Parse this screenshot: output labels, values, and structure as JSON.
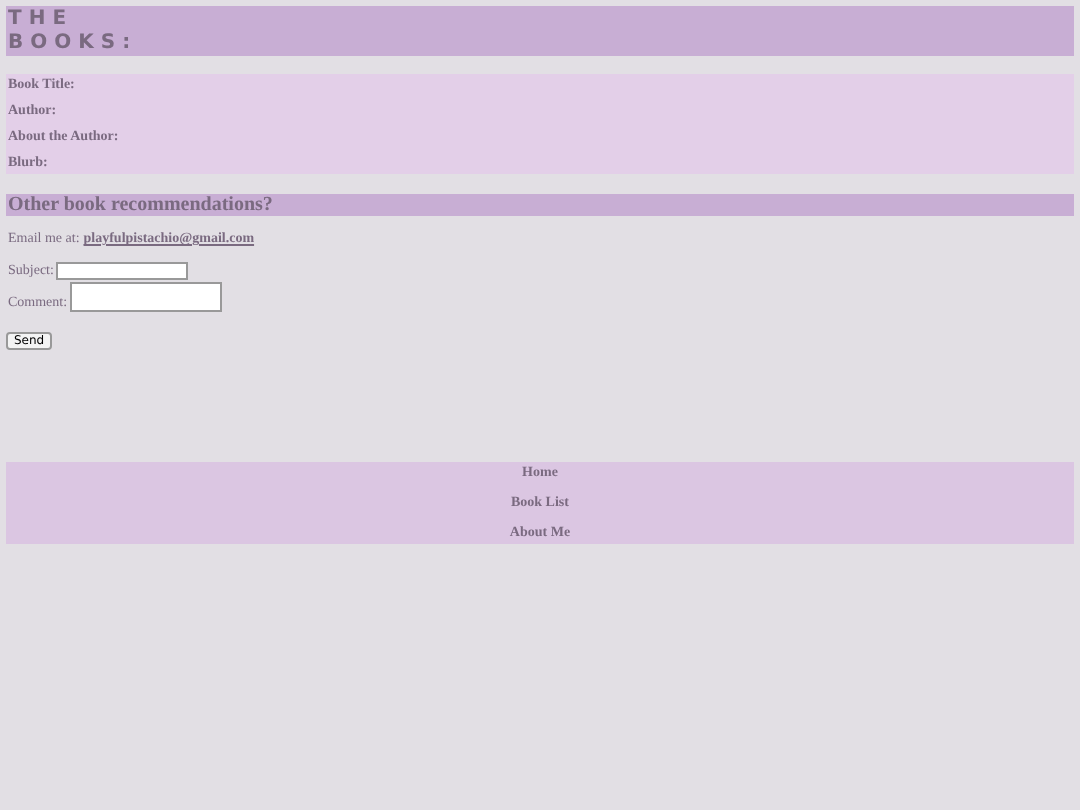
{
  "header": {
    "title": "THE BOOKS:"
  },
  "book_fields": [
    "Book Title:",
    "Author:",
    "About the Author:",
    "Blurb:"
  ],
  "recommendations": {
    "heading": "Other book recommendations?",
    "email_label": "Email me at:",
    "email_link": "playfulpistachio@gmail.com",
    "subject_label": "Subject:",
    "comment_label": "Comment:",
    "send_button": "Send"
  },
  "nav": [
    "Home",
    "Book List",
    "About Me"
  ]
}
